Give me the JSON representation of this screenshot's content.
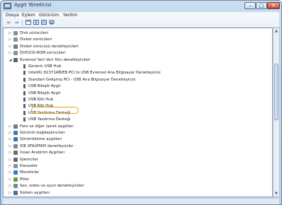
{
  "window": {
    "title": "Aygıt Yöneticisi"
  },
  "window_buttons": {
    "minimize": "–",
    "maximize": "□",
    "close": "✕"
  },
  "menu": [
    "Dosya",
    "Eylem",
    "Görünüm",
    "Yardım"
  ],
  "toolbar": {
    "back_glyph": "⇐",
    "forward_glyph": "⇒",
    "icons": [
      "properties-icon",
      "help-icon",
      "view-icon",
      "scan-icon"
    ]
  },
  "tree": [
    {
      "label": "Disk sürücüleri",
      "level": 0,
      "expander": "▷",
      "icon": "disk-drive-icon",
      "color": "#8a8f96"
    },
    {
      "label": "Disket sürücüleri",
      "level": 0,
      "expander": "▷",
      "icon": "floppy-drive-icon",
      "color": "#8a8f96"
    },
    {
      "label": "Disket sürücüsü denetleyicileri",
      "level": 0,
      "expander": "▷",
      "icon": "floppy-controller-icon",
      "color": "#6e7b8a"
    },
    {
      "label": "DVD/CD-ROM sürücüleri",
      "level": 0,
      "expander": "▷",
      "icon": "dvd-icon",
      "color": "#8a8f96"
    },
    {
      "label": "Evrensel Seri Veri Yolu denetleyicileri",
      "level": 0,
      "expander": "◢",
      "icon": "usb-controller-icon",
      "color": "#5a6470"
    },
    {
      "label": "Generic USB Hub",
      "level": 1,
      "expander": "",
      "icon": "usb-device-icon",
      "color": "#5a6470"
    },
    {
      "label": "Intel(R) 82371AB/EB PCI to USB Evrensel Ana Bilgisayar Denetleyicisi",
      "level": 1,
      "expander": "",
      "icon": "usb-device-icon",
      "color": "#5a6470"
    },
    {
      "label": "Standart Gelişmiş PCI - USB Ana Bilgisayar Denetleyicisi",
      "level": 1,
      "expander": "",
      "icon": "usb-device-icon",
      "color": "#5a6470"
    },
    {
      "label": "USB Bileşik Aygıt",
      "level": 1,
      "expander": "",
      "icon": "usb-device-icon",
      "color": "#5a6470"
    },
    {
      "label": "USB Bileşik Aygıt",
      "level": 1,
      "expander": "",
      "icon": "usb-device-icon",
      "color": "#5a6470"
    },
    {
      "label": "USB Kök Hub",
      "level": 1,
      "expander": "",
      "icon": "usb-device-icon",
      "color": "#5a6470"
    },
    {
      "label": "USB Kök Hub",
      "level": 1,
      "expander": "",
      "icon": "usb-device-icon",
      "color": "#5a6470"
    },
    {
      "label": "USB Yazdırma Desteği",
      "level": 1,
      "expander": "",
      "icon": "usb-device-icon",
      "color": "#5a6470"
    },
    {
      "label": "USB Yazdırma Desteği",
      "level": 1,
      "expander": "",
      "icon": "usb-device-icon",
      "color": "#5a6470"
    },
    {
      "label": "Fare ve diğer işaret aygıtları",
      "level": 0,
      "expander": "▷",
      "icon": "mouse-icon",
      "color": "#6f7a86"
    },
    {
      "label": "Görüntü bağdaştırıcıları",
      "level": 0,
      "expander": "▷",
      "icon": "display-adapter-icon",
      "color": "#3b7bc8"
    },
    {
      "label": "Görüntüleme aygıtları",
      "level": 0,
      "expander": "▷",
      "icon": "imaging-device-icon",
      "color": "#4a6f9c"
    },
    {
      "label": "IDE ATA/ATAPI denetleyiciler",
      "level": 0,
      "expander": "▷",
      "icon": "ide-controller-icon",
      "color": "#7d8794"
    },
    {
      "label": "İnsan Arabirim Aygıtları",
      "level": 0,
      "expander": "▷",
      "icon": "hid-icon",
      "color": "#7a6a56"
    },
    {
      "label": "İşlemciler",
      "level": 0,
      "expander": "▷",
      "icon": "processor-icon",
      "color": "#5c6b7c"
    },
    {
      "label": "Klavyeler",
      "level": 0,
      "expander": "▷",
      "icon": "keyboard-icon",
      "color": "#8a8f96"
    },
    {
      "label": "Monitörler",
      "level": 0,
      "expander": "▷",
      "icon": "monitor-icon",
      "color": "#3b7bc8"
    },
    {
      "label": "Piller",
      "level": 0,
      "expander": "▷",
      "icon": "battery-icon",
      "color": "#6a9c3a"
    },
    {
      "label": "Ses, video ve oyun denetleyicileri",
      "level": 0,
      "expander": "▷",
      "icon": "sound-icon",
      "color": "#7d8794"
    },
    {
      "label": "Sistem aygıtları",
      "level": 0,
      "expander": "▷",
      "icon": "system-device-icon",
      "color": "#4a6f9c"
    }
  ],
  "highlight_color": "#e6a217"
}
